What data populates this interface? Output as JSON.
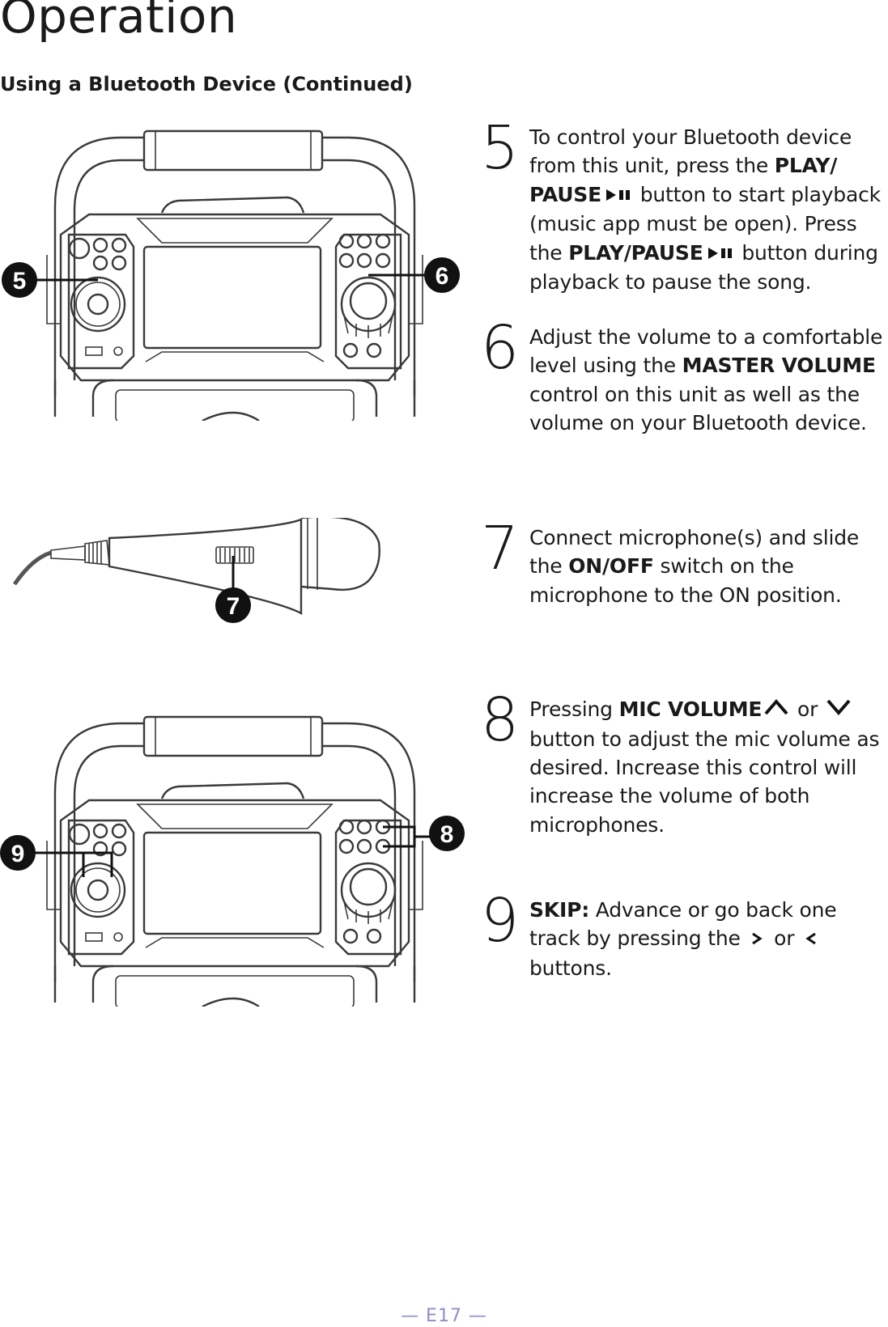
{
  "page": {
    "title": "Operation",
    "subtitle": "Using a Bluetooth Device (Continued)",
    "footer": "— E17 —",
    "footer_color": "#8c8fc9"
  },
  "steps": [
    {
      "number": "5",
      "segments": [
        {
          "t": "To control your Bluetooth device from this unit, press the ",
          "b": false
        },
        {
          "t": "PLAY/ PAUSE",
          "b": true
        },
        {
          "icon": "play-pause-icon"
        },
        {
          "t": " button to start playback (music app must be open). Press the ",
          "b": false
        },
        {
          "t": "PLAY/PAUSE",
          "b": true
        },
        {
          "icon": "play-pause-icon"
        },
        {
          "t": " button during playback to pause the song.",
          "b": false
        }
      ]
    },
    {
      "number": "6",
      "segments": [
        {
          "t": "Adjust the volume to a comfortable level using the ",
          "b": false
        },
        {
          "t": "MASTER VOLUME",
          "b": true
        },
        {
          "t": " control on this unit as well as the volume on your Bluetooth device.",
          "b": false
        }
      ]
    },
    {
      "number": "7",
      "segments": [
        {
          "t": "Connect microphone(s) and slide the ",
          "b": false
        },
        {
          "t": "ON/OFF",
          "b": true
        },
        {
          "t": " switch on the microphone to the ON position.",
          "b": false
        }
      ]
    },
    {
      "number": "8",
      "segments": [
        {
          "t": "Pressing ",
          "b": false
        },
        {
          "t": "MIC VOLUME",
          "b": true
        },
        {
          "icon": "chevron-up-icon"
        },
        {
          "t": " or ",
          "b": false
        },
        {
          "icon": "chevron-down-icon"
        },
        {
          "t": " button to adjust the mic volume as desired. Increase this control will increase the volume of both microphones.",
          "b": false
        }
      ]
    },
    {
      "number": "9",
      "segments": [
        {
          "t": "SKIP:",
          "b": true
        },
        {
          "t": " Advance or go back one track by pressing the ",
          "b": false
        },
        {
          "icon": "chevron-right-icon"
        },
        {
          "t": " or ",
          "b": false
        },
        {
          "icon": "chevron-left-icon"
        },
        {
          "t": " buttons.",
          "b": false
        }
      ]
    }
  ],
  "illustrations": {
    "unit_top": {
      "callouts": [
        "5",
        "6"
      ]
    },
    "microphone": {
      "callouts": [
        "7"
      ]
    },
    "unit_bottom": {
      "callouts": [
        "9",
        "8"
      ]
    }
  }
}
